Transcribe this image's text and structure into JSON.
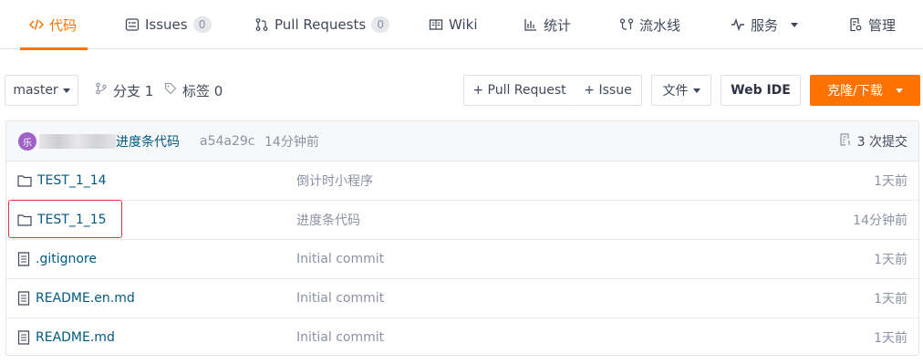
{
  "tabs": [
    {
      "label": "代码",
      "icon": "code-icon",
      "active": true
    },
    {
      "label": "Issues",
      "icon": "issue-icon",
      "badge": "0"
    },
    {
      "label": "Pull Requests",
      "icon": "pull-request-icon",
      "badge": "0"
    },
    {
      "label": "Wiki",
      "icon": "wiki-book-icon"
    },
    {
      "label": "统计",
      "icon": "bar-chart-icon"
    },
    {
      "label": "流水线",
      "icon": "pipeline-icon"
    },
    {
      "label": "服务",
      "icon": "pulse-icon"
    },
    {
      "label": "管理",
      "icon": "settings-doc-icon"
    }
  ],
  "toolbar": {
    "branch_select": "master",
    "branches_label": "分支 1",
    "tags_label": "标签 0",
    "new_pr": "+ Pull Request",
    "new_issue": "+ Issue",
    "file_menu": "文件",
    "web_ide": "Web IDE",
    "clone_download": "克隆/下载"
  },
  "commit": {
    "avatar_text": "乐",
    "message": "进度条代码",
    "hash": "a54a29c",
    "time": "14分钟前",
    "commit_count": "3 次提交"
  },
  "files": [
    {
      "name": "TEST_1_14",
      "type": "folder",
      "message": "倒计时小程序",
      "time": "1天前"
    },
    {
      "name": "TEST_1_15",
      "type": "folder",
      "message": "进度条代码",
      "time": "14分钟前"
    },
    {
      "name": ".gitignore",
      "type": "file",
      "message": "Initial commit",
      "time": "1天前"
    },
    {
      "name": "README.en.md",
      "type": "file",
      "message": "Initial commit",
      "time": "1天前"
    },
    {
      "name": "README.md",
      "type": "file",
      "message": "Initial commit",
      "time": "1天前"
    }
  ],
  "colors": {
    "accent": "#fe7300",
    "link": "#005980",
    "highlight": "#e0383e"
  }
}
